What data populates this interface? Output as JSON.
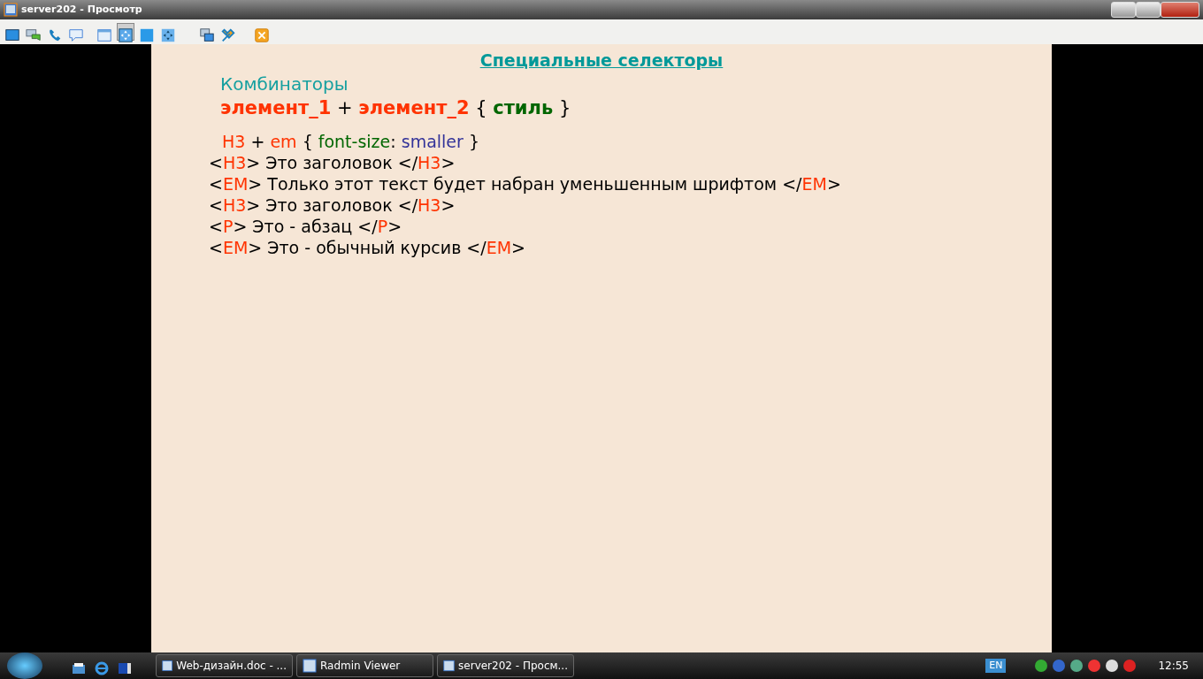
{
  "window": {
    "title": "server202 - Просмотр"
  },
  "toolbar": [
    {
      "selected": false
    },
    {
      "selected": false
    },
    {
      "selected": false
    },
    {
      "selected": false
    },
    {
      "selected": false
    },
    {
      "selected": true
    },
    {
      "selected": false
    },
    {
      "selected": false
    },
    {
      "selected": false
    },
    {
      "selected": false
    },
    {
      "selected": false
    }
  ],
  "slide": {
    "title": "Специальные селекторы",
    "subtitle": "Комбинаторы",
    "syntax": [
      {
        "text": "элемент_1",
        "color": "#ff3300"
      },
      {
        "text": " + ",
        "color": "#000000"
      },
      {
        "text": "элемент_2",
        "color": "#ff3300"
      },
      {
        "text": " { ",
        "color": "#000000"
      },
      {
        "text": "стиль",
        "color": "#006600"
      },
      {
        "text": " }",
        "color": "#000000"
      }
    ],
    "rule": [
      {
        "text": "H3",
        "color": "#ff3300"
      },
      {
        "text": " + ",
        "color": "#000000"
      },
      {
        "text": "em",
        "color": "#ff3300"
      },
      {
        "text": " { ",
        "color": "#000000"
      },
      {
        "text": "font-size",
        "color": "#006600"
      },
      {
        "text": ": ",
        "color": "#000000"
      },
      {
        "text": "smaller",
        "color": "#333399"
      },
      {
        "text": " }",
        "color": "#000000"
      }
    ],
    "lines": [
      {
        "segments": [
          {
            "text": "<",
            "color": "#000000"
          },
          {
            "text": "H3",
            "color": "#ff3300"
          },
          {
            "text": "> Это заголовок </",
            "color": "#000000"
          },
          {
            "text": "H3",
            "color": "#ff3300"
          },
          {
            "text": ">",
            "color": "#000000"
          }
        ]
      },
      {
        "segments": [
          {
            "text": "<",
            "color": "#000000"
          },
          {
            "text": "EM",
            "color": "#ff3300"
          },
          {
            "text": "> Только этот текст будет набран уменьшенным шрифтом </",
            "color": "#000000"
          },
          {
            "text": "EM",
            "color": "#ff3300"
          },
          {
            "text": ">",
            "color": "#000000"
          }
        ]
      },
      {
        "segments": [
          {
            "text": "<",
            "color": "#000000"
          },
          {
            "text": "H3",
            "color": "#ff3300"
          },
          {
            "text": "> Это заголовок </",
            "color": "#000000"
          },
          {
            "text": "H3",
            "color": "#ff3300"
          },
          {
            "text": ">",
            "color": "#000000"
          }
        ]
      },
      {
        "segments": [
          {
            "text": "<",
            "color": "#000000"
          },
          {
            "text": "P",
            "color": "#ff3300"
          },
          {
            "text": "> Это - абзац </",
            "color": "#000000"
          },
          {
            "text": "P",
            "color": "#ff3300"
          },
          {
            "text": ">",
            "color": "#000000"
          }
        ]
      },
      {
        "segments": [
          {
            "text": "<",
            "color": "#000000"
          },
          {
            "text": "EM",
            "color": "#ff3300"
          },
          {
            "text": "> Это - обычный курсив </",
            "color": "#000000"
          },
          {
            "text": "EM",
            "color": "#ff3300"
          },
          {
            "text": ">",
            "color": "#000000"
          }
        ]
      }
    ]
  },
  "taskbar": {
    "buttons": [
      {
        "label": "Web-дизайн.doc - ..."
      },
      {
        "label": "Radmin Viewer"
      },
      {
        "label": "server202 - Просм..."
      }
    ],
    "tray": {
      "language": "EN",
      "clock": "12:55"
    }
  }
}
